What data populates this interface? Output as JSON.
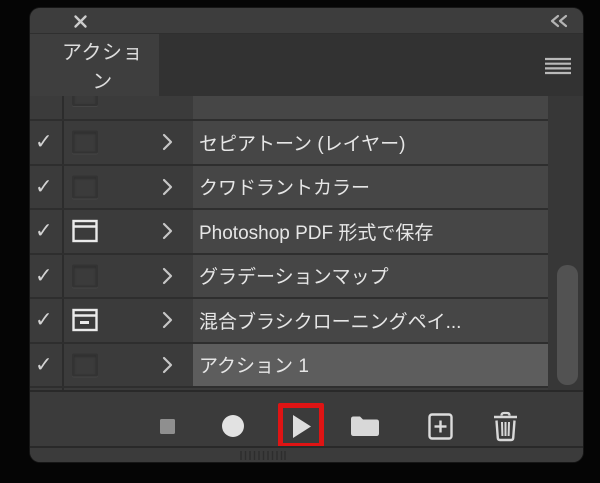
{
  "panel": {
    "tab_title": "アクション",
    "colors": {
      "panel_bg": "#3b3b3b",
      "active_tab_bg": "#3e3e3e",
      "row_name_cell_bg": "#464646",
      "selected_row_bg": "#5d5d5d",
      "annotation_red": "#df1414",
      "icon_gray": "#d8d8d8"
    }
  },
  "actions": {
    "check_glyph": "✓",
    "rows": [
      {
        "partial": true,
        "label": "",
        "checked": true,
        "dialog": "off",
        "selected": false
      },
      {
        "partial": false,
        "label": "セピアトーン (レイヤー)",
        "checked": true,
        "dialog": "off",
        "selected": false
      },
      {
        "partial": false,
        "label": "クワドラントカラー",
        "checked": true,
        "dialog": "off",
        "selected": false
      },
      {
        "partial": false,
        "label": "Photoshop PDF 形式で保存",
        "checked": true,
        "dialog": "on",
        "selected": false
      },
      {
        "partial": false,
        "label": "グラデーションマップ",
        "checked": true,
        "dialog": "off",
        "selected": false
      },
      {
        "partial": false,
        "label": "混合ブラシクローニングペイ...",
        "checked": true,
        "dialog": "partial",
        "selected": false
      },
      {
        "partial": false,
        "label": "アクション 1",
        "checked": true,
        "dialog": "off",
        "selected": true
      }
    ]
  },
  "toolbar": {
    "buttons": [
      {
        "id": "stop",
        "icon": "stop-square-icon"
      },
      {
        "id": "record",
        "icon": "record-circle-icon"
      },
      {
        "id": "play",
        "icon": "play-triangle-icon",
        "highlighted": true
      },
      {
        "id": "new-set",
        "icon": "folder-icon"
      },
      {
        "id": "new-action",
        "icon": "plus-square-icon"
      },
      {
        "id": "delete",
        "icon": "trash-icon"
      }
    ],
    "annotation": {
      "highlighted_button": "play",
      "color": "#df1414"
    }
  },
  "window_controls": {
    "close_icon": "✕",
    "collapse_icon": "«",
    "panel_menu_icon": "≣"
  },
  "scrollbar": {
    "thumb_visible": true
  }
}
